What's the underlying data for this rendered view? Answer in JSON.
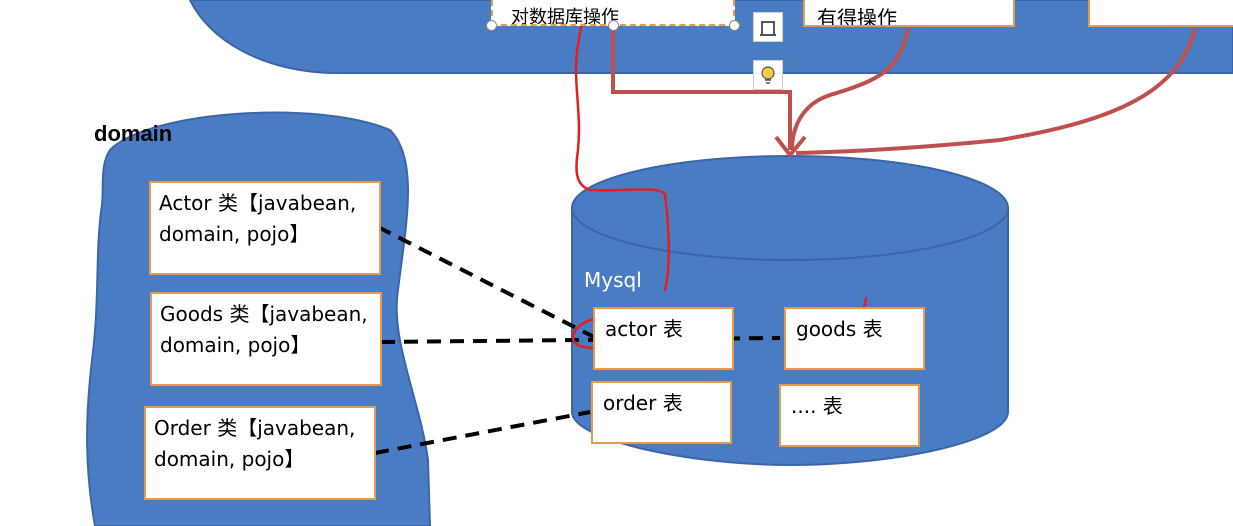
{
  "domain_label": "domain",
  "db_label": "Mysql",
  "classes": [
    {
      "text": "Actor 类【javabean,\ndomain, pojo】"
    },
    {
      "text": "Goods 类【javabean,\ndomain, pojo】"
    },
    {
      "text": "Order 类【javabean,\ndomain, pojo】"
    }
  ],
  "tables": [
    {
      "text": "actor 表"
    },
    {
      "text": "goods 表"
    },
    {
      "text": "order 表"
    },
    {
      "text": ".... 表"
    }
  ],
  "top_boxes": [
    {
      "text": "对数据库操作"
    },
    {
      "text": "有得操作"
    }
  ],
  "colors": {
    "blue": "#4a7cc3",
    "box_border": "#e69a4c",
    "annotation_red": "#e02020",
    "arrow": "#c0504d",
    "cursor": "#1db07a"
  },
  "icons": [
    "frame-icon",
    "lightbulb-icon",
    "cursor-icon"
  ]
}
